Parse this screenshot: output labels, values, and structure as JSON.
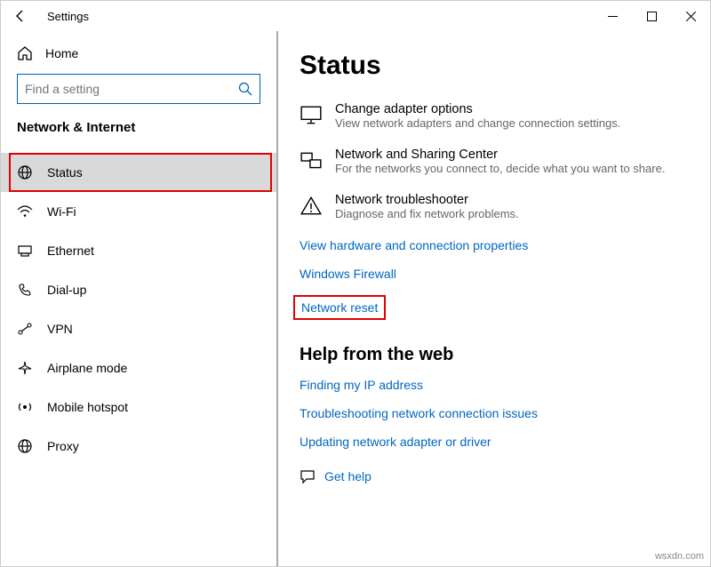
{
  "window": {
    "title": "Settings"
  },
  "sidebar": {
    "home_label": "Home",
    "search_placeholder": "Find a setting",
    "section_title": "Network & Internet",
    "items": [
      {
        "label": "Status"
      },
      {
        "label": "Wi-Fi"
      },
      {
        "label": "Ethernet"
      },
      {
        "label": "Dial-up"
      },
      {
        "label": "VPN"
      },
      {
        "label": "Airplane mode"
      },
      {
        "label": "Mobile hotspot"
      },
      {
        "label": "Proxy"
      }
    ]
  },
  "content": {
    "title": "Status",
    "settings": [
      {
        "title": "Change adapter options",
        "desc": "View network adapters and change connection settings."
      },
      {
        "title": "Network and Sharing Center",
        "desc": "For the networks you connect to, decide what you want to share."
      },
      {
        "title": "Network troubleshooter",
        "desc": "Diagnose and fix network problems."
      }
    ],
    "links": [
      "View hardware and connection properties",
      "Windows Firewall",
      "Network reset"
    ],
    "help_title": "Help from the web",
    "help_links": [
      "Finding my IP address",
      "Troubleshooting network connection issues",
      "Updating network adapter or driver"
    ],
    "get_help_label": "Get help"
  },
  "watermark": "wsxdn.com"
}
